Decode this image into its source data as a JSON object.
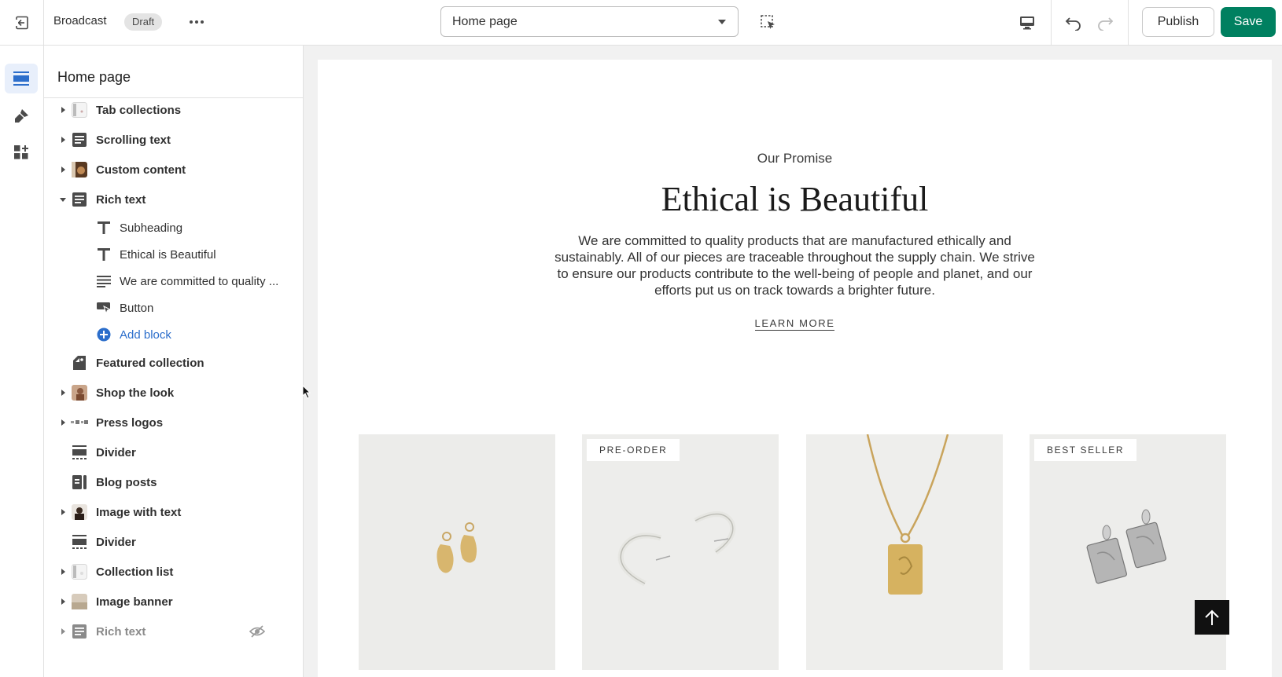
{
  "topbar": {
    "theme_name": "Broadcast",
    "status_badge": "Draft",
    "page_selector": "Home page",
    "publish_label": "Publish",
    "save_label": "Save"
  },
  "rail": {
    "items": [
      {
        "icon": "sections-icon",
        "active": true
      },
      {
        "icon": "theme-settings-icon",
        "active": false
      },
      {
        "icon": "apps-icon",
        "active": false
      }
    ]
  },
  "sidebar": {
    "title": "Home page",
    "sections": [
      {
        "label": "Tab collections",
        "icon": "thumbnail",
        "expandable": true
      },
      {
        "label": "Scrolling text",
        "icon": "text-section-icon",
        "expandable": true
      },
      {
        "label": "Custom content",
        "icon": "thumbnail",
        "expandable": true
      },
      {
        "label": "Rich text",
        "icon": "text-section-icon",
        "expanded": true
      },
      {
        "label": "Featured collection",
        "icon": "tag-icon",
        "expandable": false
      },
      {
        "label": "Shop the look",
        "icon": "thumbnail",
        "expandable": true
      },
      {
        "label": "Press logos",
        "icon": "thumbnail",
        "expandable": true
      },
      {
        "label": "Divider",
        "icon": "divider-icon",
        "expandable": false
      },
      {
        "label": "Blog posts",
        "icon": "blog-icon",
        "expandable": false
      },
      {
        "label": "Image with text",
        "icon": "thumbnail",
        "expandable": true
      },
      {
        "label": "Divider",
        "icon": "divider-icon",
        "expandable": false
      },
      {
        "label": "Collection list",
        "icon": "thumbnail",
        "expandable": true
      },
      {
        "label": "Image banner",
        "icon": "thumbnail",
        "expandable": true
      },
      {
        "label": "Rich text",
        "icon": "text-section-icon",
        "expandable": true,
        "hidden": true
      }
    ],
    "rich_text_blocks": [
      {
        "label": "Subheading",
        "icon": "type-icon"
      },
      {
        "label": "Ethical is Beautiful",
        "icon": "type-icon"
      },
      {
        "label": "We are committed to quality ...",
        "icon": "paragraph-icon"
      },
      {
        "label": "Button",
        "icon": "button-icon"
      }
    ],
    "add_block_label": "Add block"
  },
  "preview": {
    "subheading": "Our Promise",
    "heading": "Ethical is Beautiful",
    "body": "We are committed to quality products that are manufactured ethically and sustainably. All of our pieces are traceable throughout the supply chain. We strive to ensure our products contribute to the well-being of people and planet, and our efforts put us on track towards a brighter future.",
    "button_label": "LEARN MORE",
    "products": [
      {
        "badge": "",
        "image": "gold-face-earrings"
      },
      {
        "badge": "PRE-ORDER",
        "image": "silver-hoop-earrings"
      },
      {
        "badge": "",
        "image": "gold-pendant-necklace"
      },
      {
        "badge": "BEST SELLER",
        "image": "silver-drop-earrings"
      }
    ]
  },
  "colors": {
    "accent": "#008060",
    "link": "#2c6ecb",
    "rail_active": "#e8effb"
  }
}
